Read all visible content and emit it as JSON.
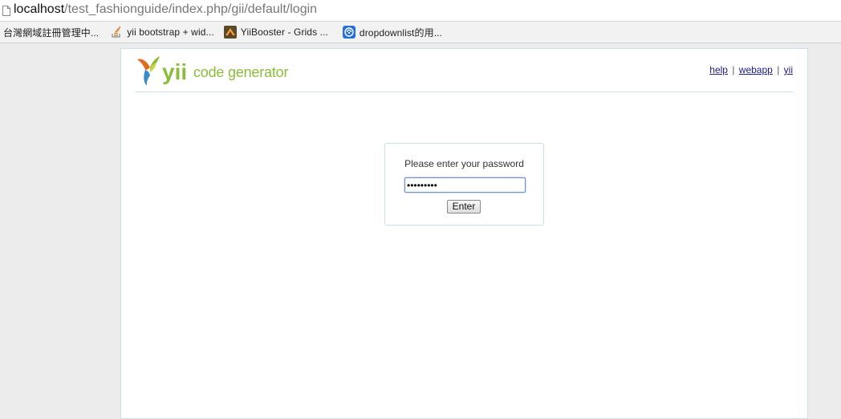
{
  "browser": {
    "url_host": "localhost",
    "url_path": "/test_fashionguide/index.php/gii/default/login"
  },
  "bookmarks": [
    {
      "label": "台灣網域註冊管理中...",
      "icon": "none"
    },
    {
      "label": "yii bootstrap + wid...",
      "icon": "stackoverflow-icon"
    },
    {
      "label": "YiiBooster - Grids ...",
      "icon": "yiibooster-icon"
    },
    {
      "label": "dropdownlist的用...",
      "icon": "globe-icon"
    }
  ],
  "header": {
    "logo_text": "yii",
    "logo_subtitle": "code generator",
    "links": [
      {
        "label": "help"
      },
      {
        "label": "webapp"
      },
      {
        "label": "yii"
      }
    ],
    "separator": "|"
  },
  "login": {
    "prompt": "Please enter your password",
    "password_value": "•••••••••",
    "submit_label": "Enter"
  },
  "colors": {
    "brand_green": "#8bbd3a",
    "border_blue": "#c9e0ed",
    "link_blue": "#1a1a8f"
  }
}
